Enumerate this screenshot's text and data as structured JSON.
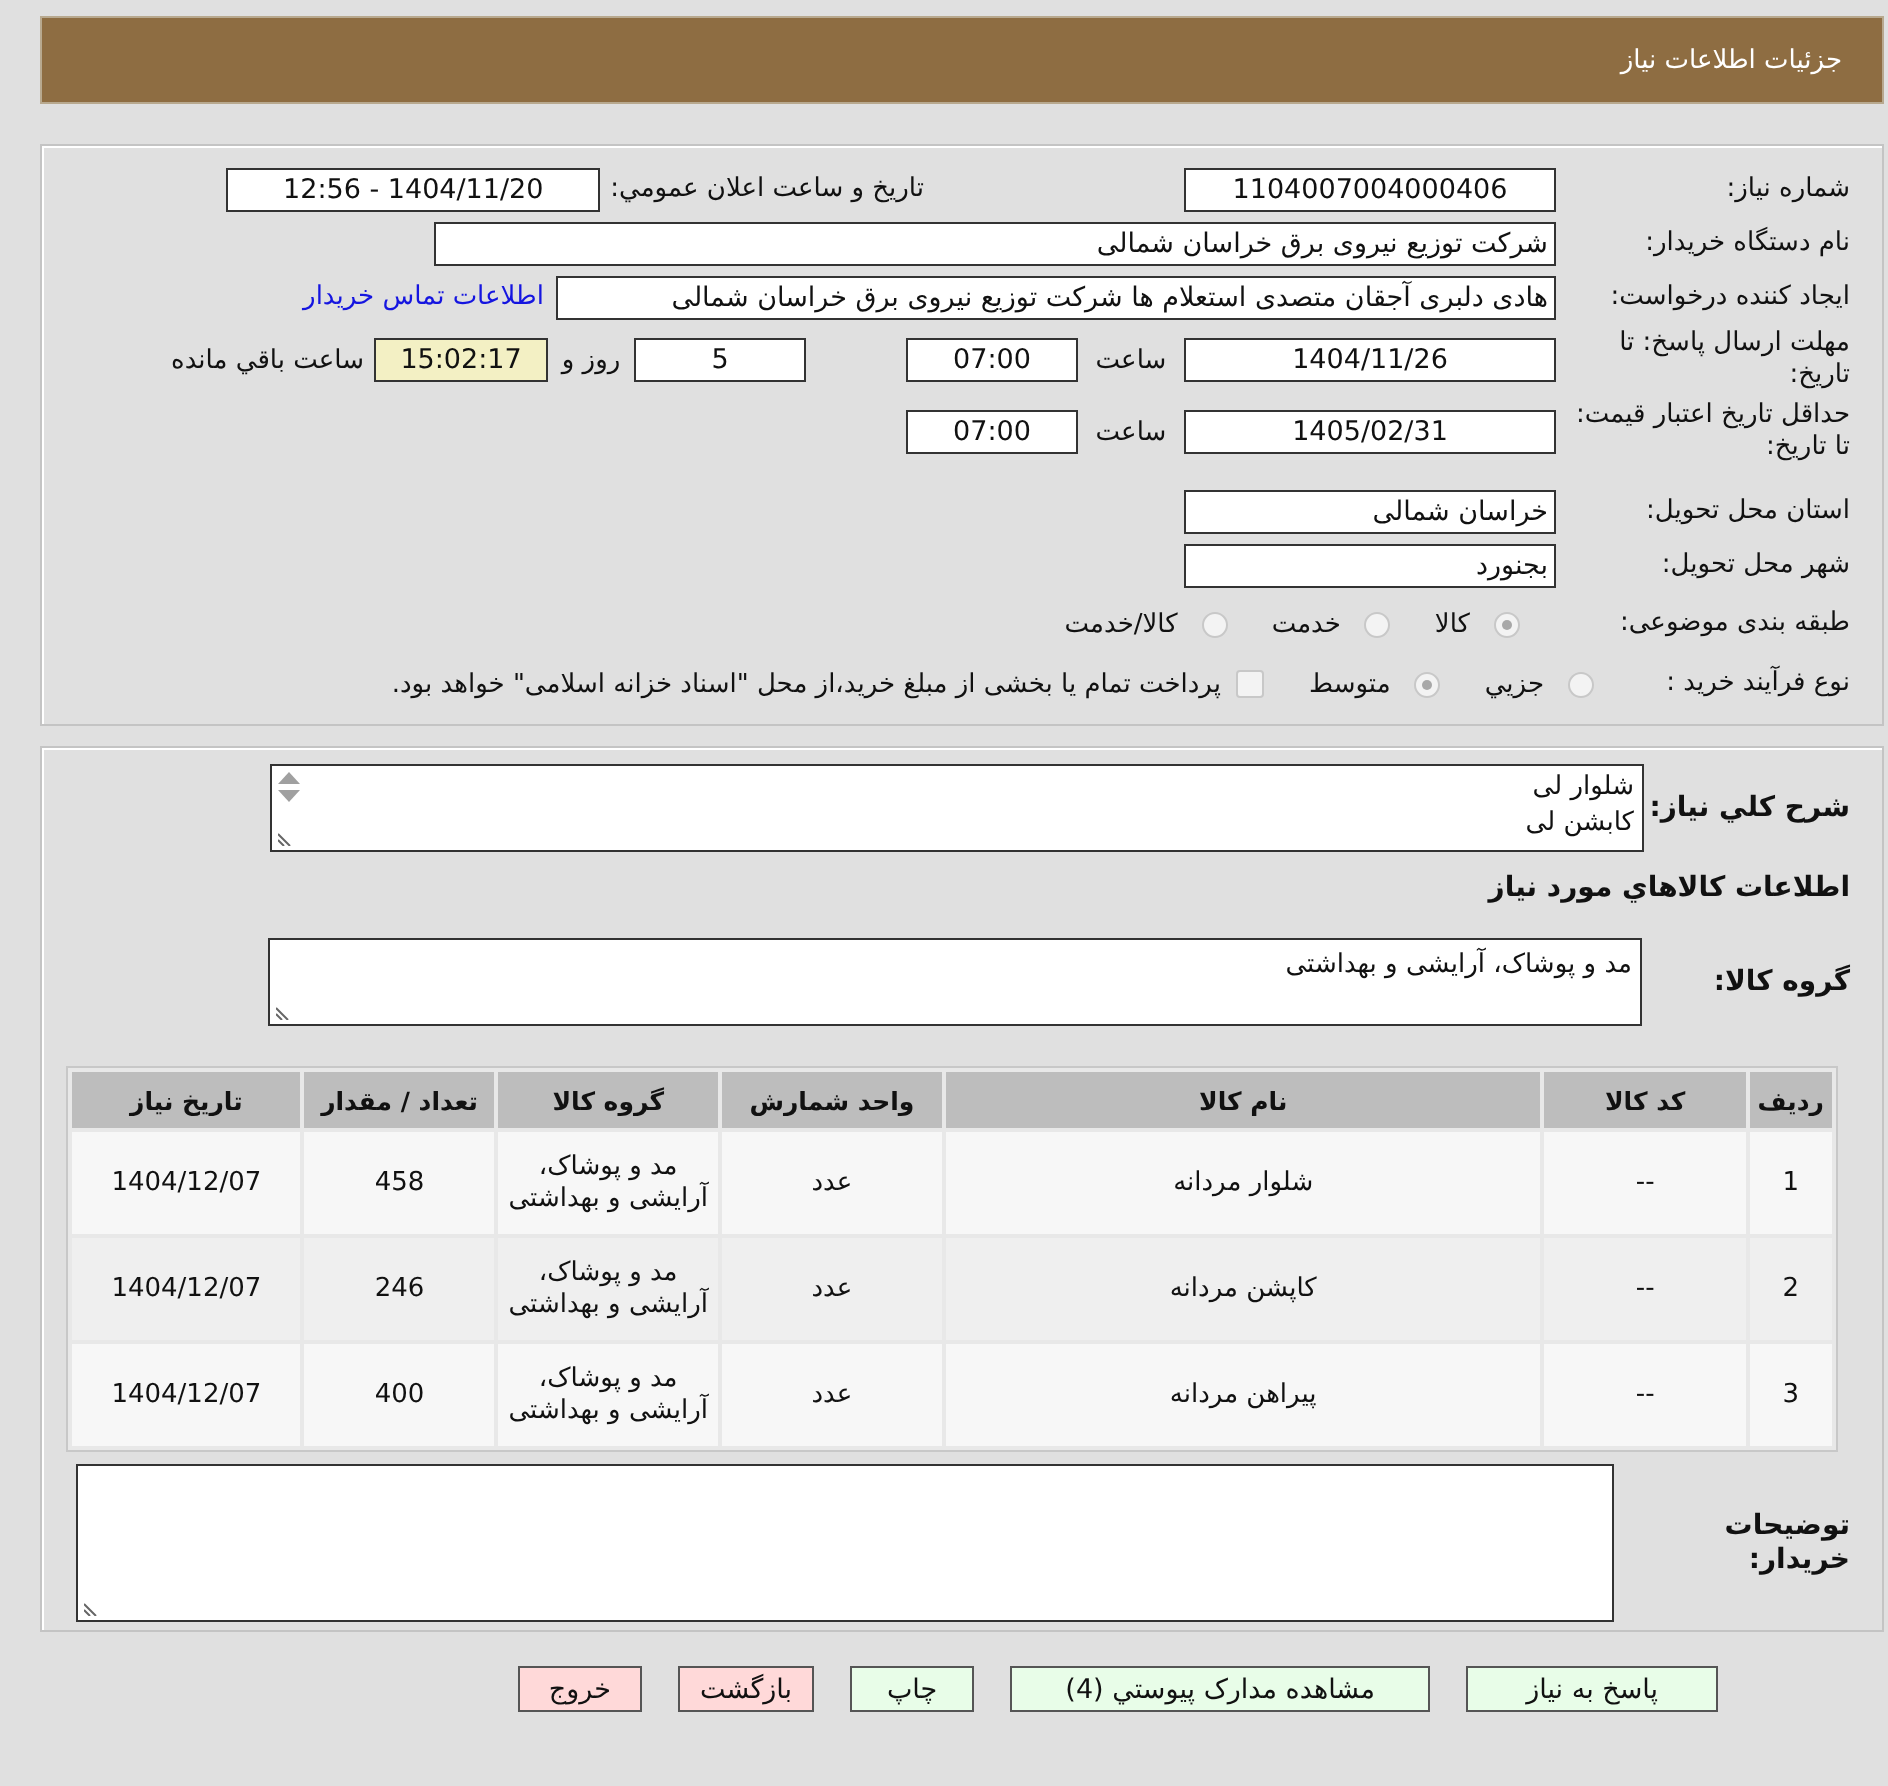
{
  "header": {
    "title": "جزئیات اطلاعات نیاز"
  },
  "need_number": {
    "label": "شماره نیاز:",
    "value": "1104007004000406"
  },
  "announce": {
    "label": "تاریخ و ساعت اعلان عمومي:",
    "value": "1404/11/20 - 12:56"
  },
  "buyer": {
    "label": "نام دستگاه خریدار:",
    "value": "شرکت توزیع نیروی برق خراسان شمالی"
  },
  "requester": {
    "label": "ایجاد کننده درخواست:",
    "value": "هادی دلبری آجقان متصدی استعلام ها شرکت توزیع نیروی برق خراسان شمالی",
    "link": "اطلاعات تماس خریدار"
  },
  "deadline": {
    "label": "مهلت ارسال پاسخ: تا تاریخ:",
    "date": "1404/11/26",
    "time_label": "ساعت",
    "time": "07:00",
    "days": "5",
    "days_label": "روز و",
    "remaining": "15:02:17",
    "remaining_label": "ساعت باقي مانده"
  },
  "validity": {
    "label": "حداقل تاریخ اعتبار قیمت: تا تاریخ:",
    "date": "1405/02/31",
    "time_label": "ساعت",
    "time": "07:00"
  },
  "province": {
    "label": "استان محل تحویل:",
    "value": "خراسان شمالی"
  },
  "city": {
    "label": "شهر محل تحویل:",
    "value": "بجنورد"
  },
  "category": {
    "label": "طبقه بندی موضوعی:",
    "options": [
      {
        "label": "کالا",
        "selected": true
      },
      {
        "label": "خدمت",
        "selected": false
      },
      {
        "label": "کالا/خدمت",
        "selected": false
      }
    ]
  },
  "process": {
    "label": "نوع فرآیند خرید :",
    "options": [
      {
        "label": "جزيي",
        "selected": false
      },
      {
        "label": "متوسط",
        "selected": true
      }
    ],
    "treasury": {
      "checked": false,
      "label": "پرداخت تمام یا بخشی از مبلغ خرید،از محل \"اسناد خزانه اسلامی\" خواهد بود."
    }
  },
  "summary": {
    "label": "شرح کلي نیاز:",
    "value": "شلوار لی\nکابشن لی"
  },
  "goods_heading": "اطلاعات کالاهاي مورد نیاز",
  "goods_group": {
    "label": "گروه کالا:",
    "value": "مد و پوشاک، آرایشی و بهداشتی"
  },
  "table": {
    "columns": [
      "ردیف",
      "کد کالا",
      "نام کالا",
      "واحد شمارش",
      "گروه کالا",
      "تعداد / مقدار",
      "تاریخ نیاز"
    ],
    "rows": [
      [
        "1",
        "--",
        "شلوار مردانه",
        "عدد",
        "مد و پوشاک، آرایشی و بهداشتی",
        "458",
        "1404/12/07"
      ],
      [
        "2",
        "--",
        "کاپشن مردانه",
        "عدد",
        "مد و پوشاک، آرایشی و بهداشتی",
        "246",
        "1404/12/07"
      ],
      [
        "3",
        "--",
        "پیراهن مردانه",
        "عدد",
        "مد و پوشاک، آرایشی و بهداشتی",
        "400",
        "1404/12/07"
      ]
    ]
  },
  "buyer_notes": {
    "label": "توضیحات خریدار:"
  },
  "buttons": [
    {
      "label": "پاسخ به نیاز",
      "color": "#e8fde8"
    },
    {
      "label": "مشاهده مدارک پیوستي (4)",
      "color": "#e8fde8"
    },
    {
      "label": "چاپ",
      "color": "#e8fde8"
    },
    {
      "label": "بازگشت",
      "color": "#ffd9d9"
    },
    {
      "label": "خروج",
      "color": "#ffd9d9"
    }
  ]
}
